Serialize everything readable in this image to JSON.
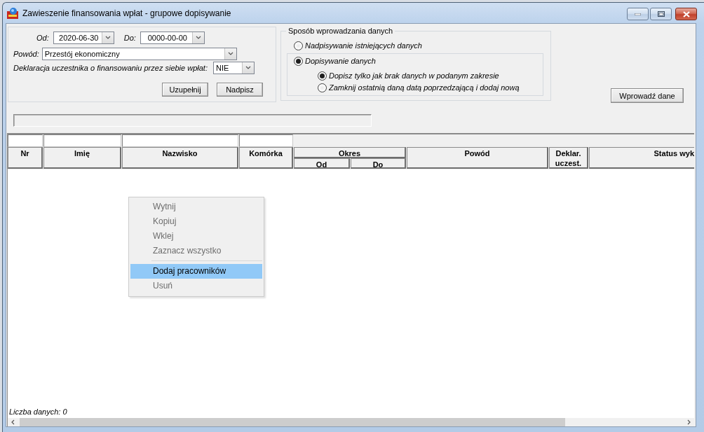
{
  "window": {
    "title": "Zawieszenie finansowania wpłat - grupowe dopisywanie"
  },
  "filters": {
    "date_from": {
      "label": "Od:",
      "value": "2020-06-30"
    },
    "date_to": {
      "label": "Do:",
      "value": "0000-00-00"
    },
    "reason": {
      "label": "Powód:",
      "value": "Przestój ekonomiczny"
    },
    "declaration": {
      "label": "Deklaracja uczestnika o finansowaniu przez siebie wpłat:",
      "value": "NIE"
    },
    "buttons": [
      "Uzupełnij",
      "Nadpisz"
    ]
  },
  "input_mode": {
    "title": "Sposób wprowadzania danych",
    "options": [
      {
        "label": "Nadpisywanie istniejących danych",
        "selected": false
      },
      {
        "label": "Dopisywanie danych",
        "selected": true,
        "children": [
          {
            "label": "Dopisz tylko jak brak danych w podanym zakresie",
            "selected": true
          },
          {
            "label": "Zamknij ostatnią daną datą poprzedzającą i dodaj nową",
            "selected": false
          }
        ]
      }
    ]
  },
  "apply_button": "Wprowadź dane",
  "progress": {
    "level": 0
  },
  "grid": {
    "columns": [
      {
        "label": "Nr",
        "filter": true
      },
      {
        "label": "Imię",
        "filter": true
      },
      {
        "label": "Nazwisko",
        "filter": true
      },
      {
        "label": "Komórka",
        "filter": true
      },
      {
        "label": "Okres",
        "filter": false,
        "children": [
          {
            "label": "Od"
          },
          {
            "label": "Do"
          }
        ]
      },
      {
        "label": "Powód",
        "filter": false
      },
      {
        "label": "Deklar. uczest.",
        "filter": false
      },
      {
        "label": "Status wyk",
        "filter": false
      }
    ],
    "footer": "Liczba danych: 0"
  },
  "context_menu": {
    "groups": [
      {
        "items": [
          {
            "label": "Wytnij",
            "disabled": true,
            "selected": false
          },
          {
            "label": "Kopiuj",
            "disabled": true,
            "selected": false
          },
          {
            "label": "Wklej",
            "disabled": true,
            "selected": false
          },
          {
            "label": "Zaznacz wszystko",
            "disabled": true,
            "selected": false
          }
        ]
      },
      {
        "items": [
          {
            "label": "Dodaj pracowników",
            "disabled": false,
            "selected": true
          },
          {
            "label": "Usuń",
            "disabled": true,
            "selected": false
          }
        ]
      }
    ]
  }
}
